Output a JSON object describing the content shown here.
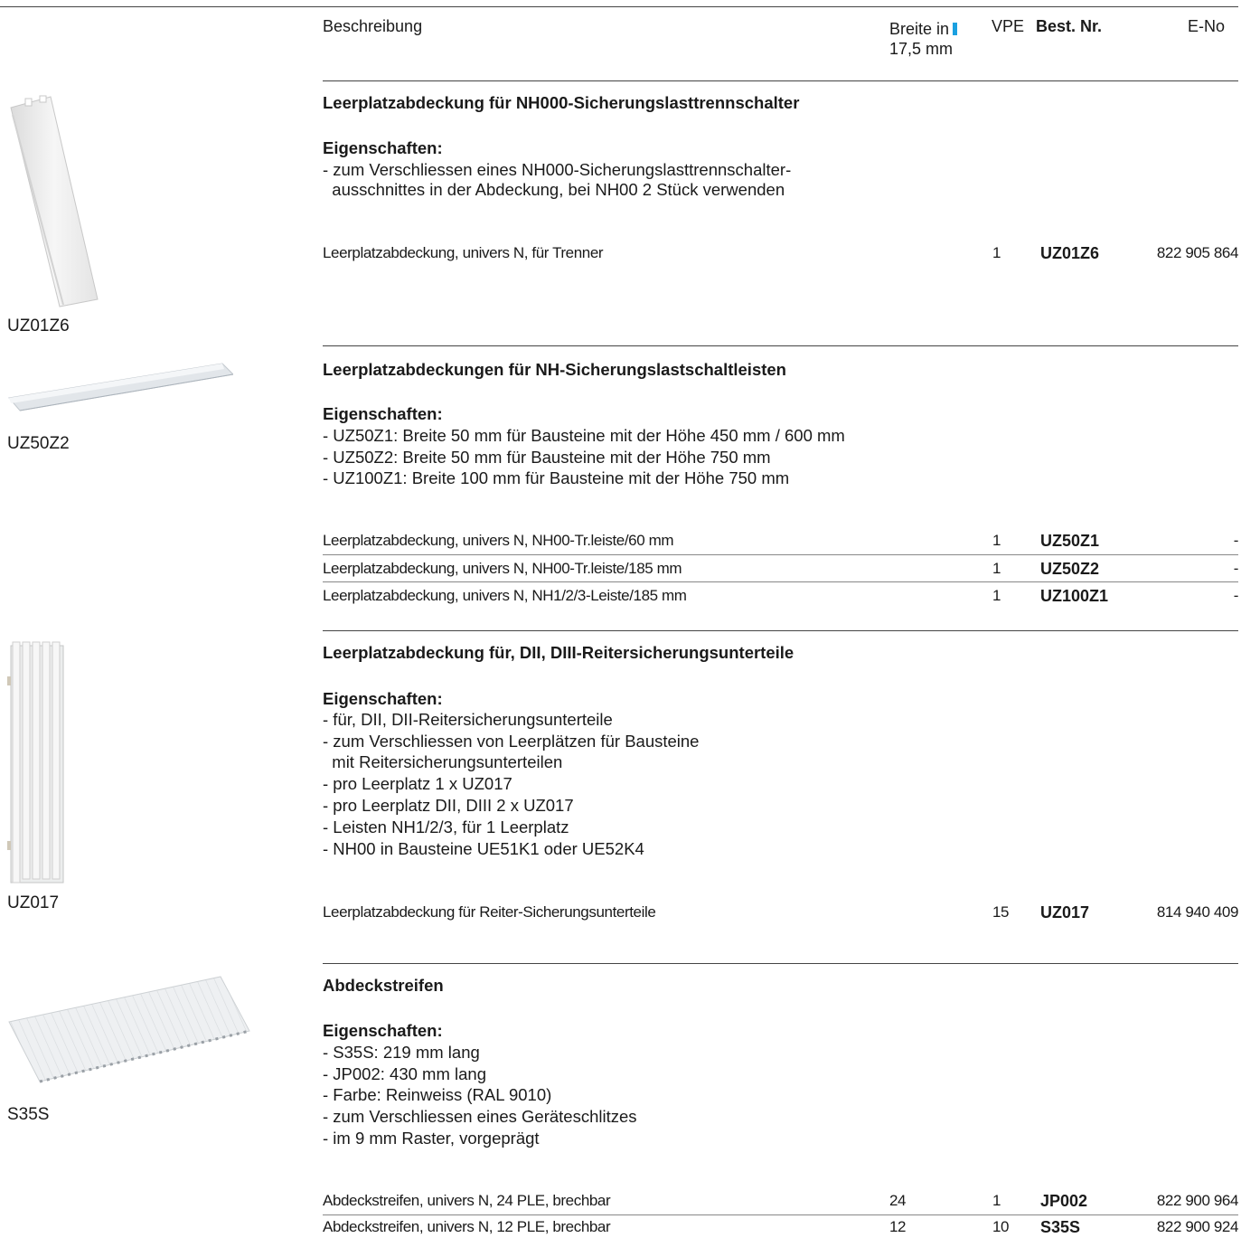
{
  "header": {
    "col_desc": "Beschreibung",
    "col_width_line1": "Breite in",
    "col_width_line2": "17,5 mm",
    "col_vpe": "VPE",
    "col_best": "Best. Nr.",
    "col_eno": "E-No",
    "accent_color": "#1aa0e0"
  },
  "sections": [
    {
      "title": "Leerplatzabdeckung für NH000-Sicherungslasttrennschalter",
      "props_label": "Eigenschaften:",
      "props": [
        "- zum Verschliessen eines NH000-Sicherungslasttrennschalter-",
        "  ausschnittes in der Abdeckung, bei NH00 2 Stück verwenden"
      ],
      "image_caption": "UZ01Z6",
      "rows": [
        {
          "desc": "Leerplatzabdeckung, univers N, für Trenner",
          "width": "",
          "vpe": "1",
          "best": "UZ01Z6",
          "eno": "822 905 864"
        }
      ]
    },
    {
      "title": "Leerplatzabdeckungen für NH-Sicherungslastschaltleisten",
      "props_label": "Eigenschaften:",
      "props": [
        "- UZ50Z1: Breite 50 mm für Bausteine mit der Höhe 450 mm / 600 mm",
        "- UZ50Z2: Breite 50 mm für Bausteine mit der Höhe 750 mm",
        "- UZ100Z1: Breite 100 mm für Bausteine mit der Höhe 750 mm"
      ],
      "image_caption": "UZ50Z2",
      "rows": [
        {
          "desc": "Leerplatzabdeckung, univers N, NH00-Tr.leiste/60 mm",
          "width": "",
          "vpe": "1",
          "best": "UZ50Z1",
          "eno": "-"
        },
        {
          "desc": "Leerplatzabdeckung, univers N, NH00-Tr.leiste/185 mm",
          "width": "",
          "vpe": "1",
          "best": "UZ50Z2",
          "eno": "-"
        },
        {
          "desc": "Leerplatzabdeckung, univers N, NH1/2/3-Leiste/185 mm",
          "width": "",
          "vpe": "1",
          "best": "UZ100Z1",
          "eno": "-"
        }
      ]
    },
    {
      "title": "Leerplatzabdeckung für, DII, DIII-Reitersicherungsunterteile",
      "props_label": "Eigenschaften:",
      "props": [
        "- für, DII, DII-Reitersicherungsunterteile",
        "- zum Verschliessen von Leerplätzen für Bausteine",
        "  mit Reitersicherungsunterteilen",
        "- pro Leerplatz 1 x UZ017",
        "- pro Leerplatz DII, DIII 2 x UZ017",
        "- Leisten NH1/2/3, für 1 Leerplatz",
        "- NH00 in Bausteine UE51K1 oder UE52K4"
      ],
      "image_caption": "UZ017",
      "rows": [
        {
          "desc": "Leerplatzabdeckung für Reiter-Sicherungsunterteile",
          "width": "",
          "vpe": "15",
          "best": "UZ017",
          "eno": "814 940 409"
        }
      ]
    },
    {
      "title": "Abdeckstreifen",
      "props_label": "Eigenschaften:",
      "props": [
        "- S35S: 219 mm lang",
        "- JP002: 430 mm lang",
        "- Farbe: Reinweiss (RAL 9010)",
        "- zum Verschliessen eines Geräteschlitzes",
        "- im 9 mm Raster, vorgeprägt"
      ],
      "image_caption": "S35S",
      "rows": [
        {
          "desc": "Abdeckstreifen, univers N, 24 PLE, brechbar",
          "width": "24",
          "vpe": "1",
          "best": "JP002",
          "eno": "822 900 964"
        },
        {
          "desc": "Abdeckstreifen, univers N, 12 PLE, brechbar",
          "width": "12",
          "vpe": "10",
          "best": "S35S",
          "eno": "822 900 924"
        }
      ]
    }
  ]
}
